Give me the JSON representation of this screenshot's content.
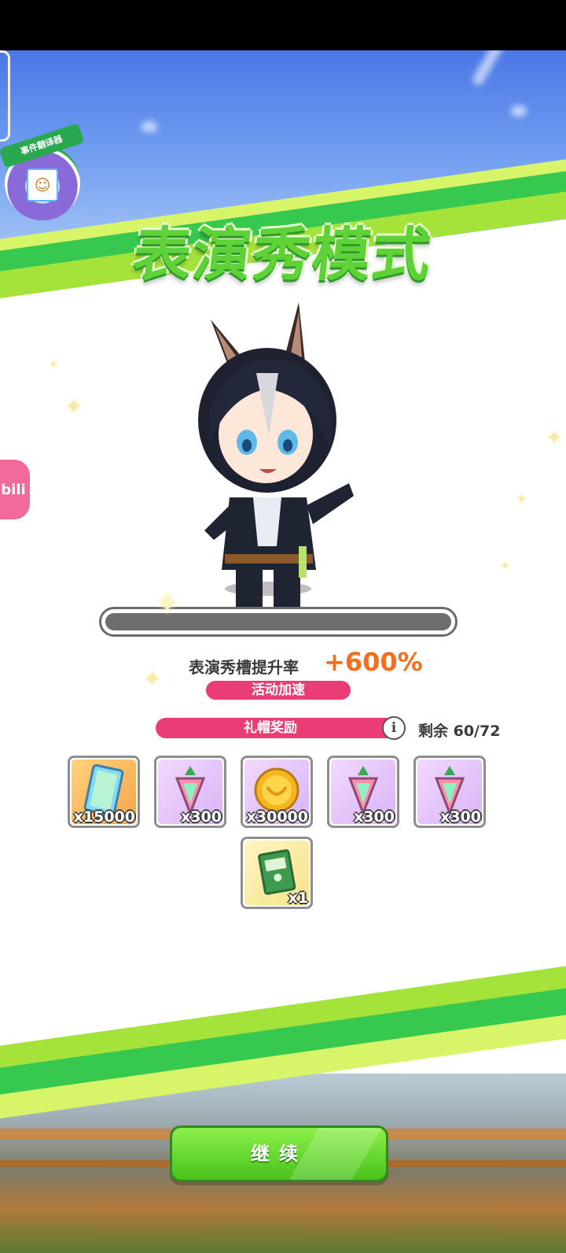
{
  "screen": {
    "title": "表演秀模式",
    "badge_label": "事件翻译器",
    "bili_tab": "bili"
  },
  "progress": {
    "fill_fraction": 0.0
  },
  "rate": {
    "label": "表演秀槽提升率",
    "value": "+600%",
    "event_label": "活动加速"
  },
  "hat_reward": {
    "label": "礼帽奖励",
    "info_icon": "info-icon",
    "remaining": "剩余 60/72"
  },
  "rewards": [
    {
      "name": "card-ticket",
      "icon": "rainbow-card-icon",
      "qty": "x15000",
      "bg": "orange"
    },
    {
      "name": "carrot-gem-1",
      "icon": "rainbow-carrot-icon",
      "qty": "x300",
      "bg": "purple"
    },
    {
      "name": "gold-coin",
      "icon": "gold-coin-icon",
      "qty": "x30000",
      "bg": "purple"
    },
    {
      "name": "carrot-gem-2",
      "icon": "rainbow-carrot-icon",
      "qty": "x300",
      "bg": "purple"
    },
    {
      "name": "carrot-gem-3",
      "icon": "rainbow-carrot-icon",
      "qty": "x300",
      "bg": "purple"
    },
    {
      "name": "book",
      "icon": "green-book-icon",
      "qty": "x1",
      "bg": "yellow"
    }
  ],
  "actions": {
    "continue_label": "继续"
  },
  "colors": {
    "accent_pink": "#ea3d76",
    "rate_orange": "#f36f1e",
    "button_green": "#48c21c",
    "title_green": "#5fd238"
  }
}
